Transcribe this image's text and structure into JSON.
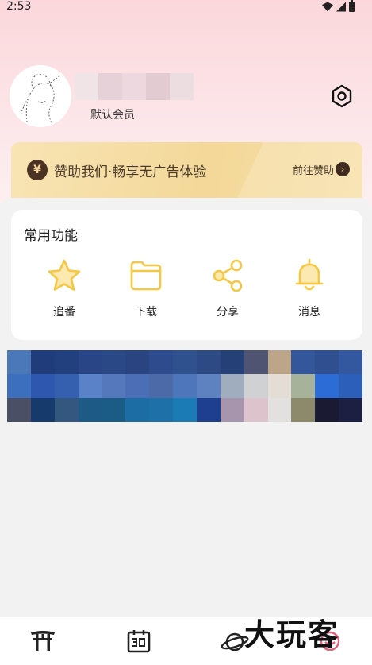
{
  "status_bar": {
    "time": "2:53"
  },
  "profile": {
    "member_label": "默认会员"
  },
  "sponsor": {
    "icon": "yen-icon",
    "text": "赞助我们·畅享无广告体验",
    "link_label": "前往赞助"
  },
  "functions": {
    "title": "常用功能",
    "items": [
      {
        "label": "追番",
        "icon": "star-icon"
      },
      {
        "label": "下载",
        "icon": "folder-icon"
      },
      {
        "label": "分享",
        "icon": "share-icon"
      },
      {
        "label": "消息",
        "icon": "bell-icon"
      }
    ]
  },
  "bottom_nav": {
    "items": [
      {
        "icon": "torii-icon"
      },
      {
        "icon": "calendar-icon"
      },
      {
        "icon": "planet-icon"
      },
      {
        "icon": "profile-icon"
      }
    ]
  },
  "watermark": {
    "text": "大玩客"
  },
  "colors": {
    "accent_yellow": "#f6c744",
    "sponsor_brown": "#4b3324",
    "header_pink": "#fbd7db"
  }
}
